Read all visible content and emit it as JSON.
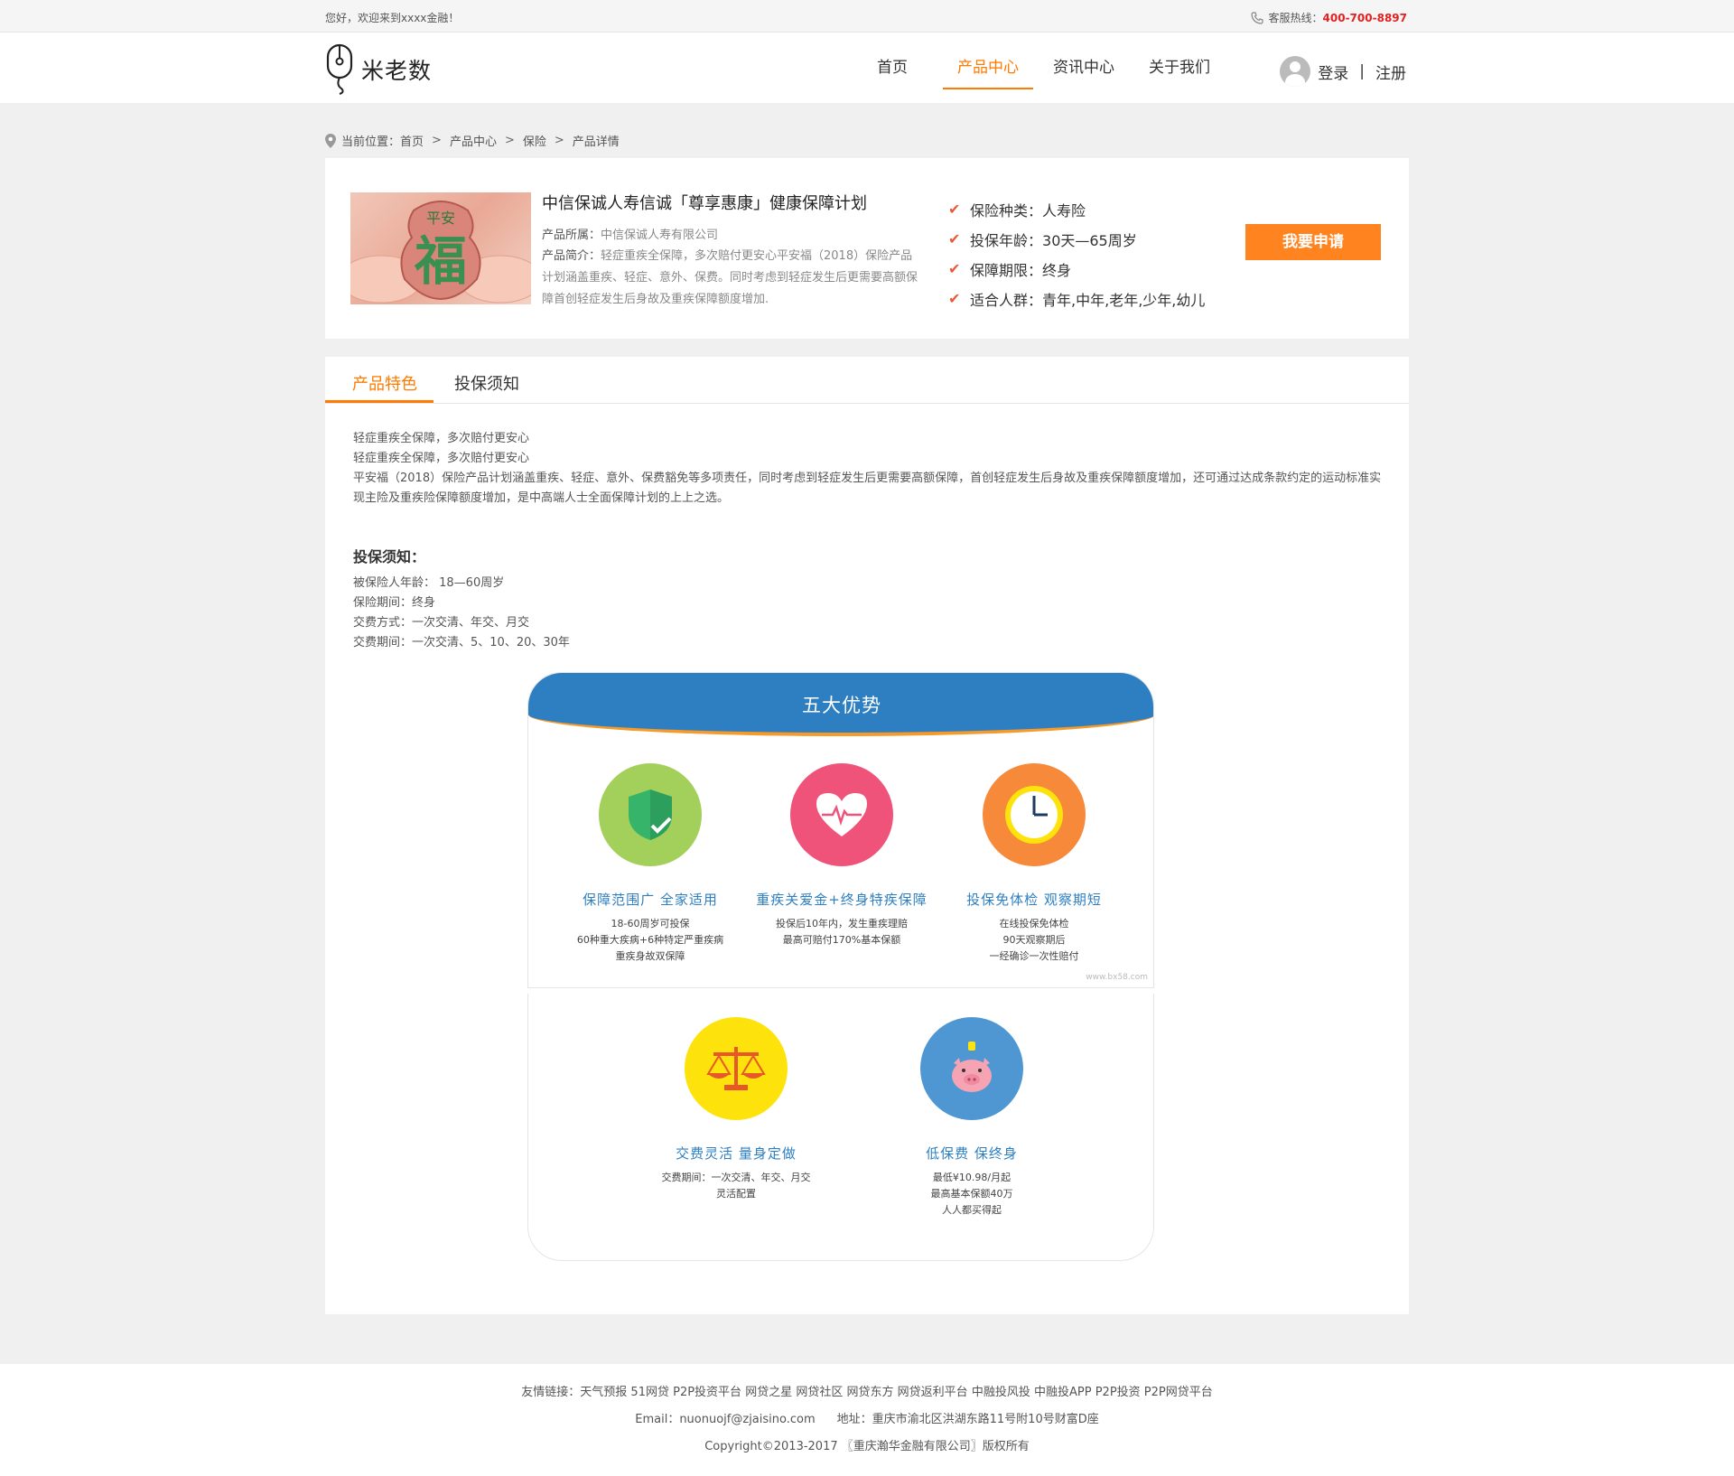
{
  "topbar": {
    "welcome": "您好，欢迎来到xxxx金融！",
    "hotline_label": "客服热线：",
    "hotline_number": "400-700-8897"
  },
  "header": {
    "logo_text": "米老数",
    "nav": [
      "首页",
      "产品中心",
      "资讯中心",
      "关于我们"
    ],
    "login": "登录",
    "separator": "|",
    "register": "注册"
  },
  "breadcrumb": {
    "label": "当前位置：",
    "items": [
      "首页",
      "产品中心",
      "保险",
      "产品详情"
    ],
    "sep": ">"
  },
  "product": {
    "title": "中信保诚人寿信诚「尊享惠康」健康保障计划",
    "owner_label": "产品所属：",
    "owner": "中信保诚人寿有限公司",
    "intro_label": "产品简介：",
    "intro": "轻症重疾全保障，多次赔付更安心平安福（2018）保险产品计划涵盖重疾、轻症、意外、保费。同时考虑到轻症发生后更需要高额保障首创轻症发生后身故及重疾保障额度增加.",
    "image_text_top": "平安",
    "image_text_main": "福",
    "attrs": [
      {
        "label": "保险种类：",
        "value": " 人寿险"
      },
      {
        "label": "投保年龄：",
        "value": "30天—65周岁"
      },
      {
        "label": "保障期限：",
        "value": "终身"
      },
      {
        "label": "适合人群：",
        "value": "青年,中年,老年,少年,幼儿"
      }
    ],
    "apply": "我要申请"
  },
  "tabs": [
    "产品特色",
    "投保须知"
  ],
  "features": [
    "轻症重疾全保障，多次赔付更安心",
    "轻症重疾全保障，多次赔付更安心",
    "平安福（2018）保险产品计划涵盖重疾、轻症、意外、保费豁免等多项责任，同时考虑到轻症发生后更需要高额保障，首创轻症发生后身故及重疾保障额度增加，还可通过达成条款约定的运动标准实现主险及重疾险保障额度增加，是中高端人士全面保障计划的上上之选。"
  ],
  "notice": {
    "title": "投保须知：",
    "items": [
      "被保险人年龄： 18—60周岁",
      "保险期间：终身",
      "交费方式：一次交清、年交、月交",
      "交费期间：一次交清、5、10、20、30年"
    ]
  },
  "advantages": {
    "title": "五大优势",
    "watermark": "www.bx58.com",
    "items": [
      {
        "name": "保障范围广  全家适用",
        "desc": [
          "18-60周岁可投保",
          "60种重大疾病+6种特定严重疾病",
          "重疾身故双保障"
        ],
        "icon": "shield-icon",
        "color": "#a3cf5b"
      },
      {
        "name": "重疾关爱金+终身特疾保障",
        "desc": [
          "投保后10年内，发生重疾理赔",
          "最高可赔付170%基本保额"
        ],
        "icon": "heart-icon",
        "color": "#f0537a"
      },
      {
        "name": "投保免体检  观察期短",
        "desc": [
          "在线投保免体检",
          "90天观察期后",
          "一经确诊一次性赔付"
        ],
        "icon": "clock-icon",
        "color": "#f7893a"
      },
      {
        "name": "交费灵活  量身定做",
        "desc": [
          "交费期间：一次交清、年交、月交",
          "灵活配置"
        ],
        "icon": "scale-icon",
        "color": "#fde30b"
      },
      {
        "name": "低保费  保终身",
        "desc": [
          "最低¥10.98/月起",
          "最高基本保额40万",
          "人人都买得起"
        ],
        "icon": "piggy-bank-icon",
        "color": "#4f97d3"
      }
    ]
  },
  "footer": {
    "links_label": "友情链接：",
    "links": [
      "天气预报",
      "51网贷",
      "P2P投资平台",
      "网贷之星",
      "网贷社区",
      "网贷东方",
      "网贷返利平台",
      "中融投风投",
      "中融投APP",
      "P2P投资",
      "P2P网贷平台"
    ],
    "email": "Email：nuonuojf@zjaisino.com",
    "address": "地址：重庆市渝北区洪湖东路11号附10号财富D座",
    "copyright": "Copyright©2013-2017  〖重庆瀚华金融有限公司〗版权所有"
  },
  "colors": {
    "accent": "#ff7a00",
    "apply_button": "#ff8420",
    "adv_blue": "#2e7fc1",
    "hotline_red": "#e02222"
  }
}
